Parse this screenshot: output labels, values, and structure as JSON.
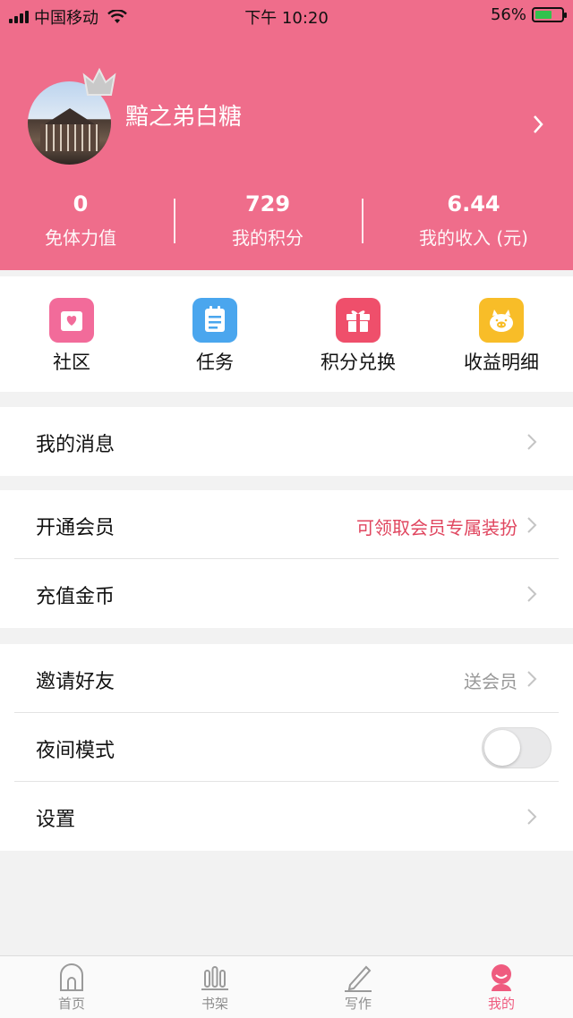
{
  "status_bar": {
    "carrier": "中国移动",
    "time": "下午 10:20",
    "battery": "56%"
  },
  "profile": {
    "username": "黯之弟白糖"
  },
  "stats": [
    {
      "value": "0",
      "label": "免体力值"
    },
    {
      "value": "729",
      "label": "我的积分"
    },
    {
      "value": "6.44",
      "label": "我的收入 (元)"
    }
  ],
  "quick_actions": [
    {
      "label": "社区",
      "icon": "community-icon",
      "color": "#f26b9a"
    },
    {
      "label": "任务",
      "icon": "task-icon",
      "color": "#4aa6ee"
    },
    {
      "label": "积分兑换",
      "icon": "gift-icon",
      "color": "#ef4f6b"
    },
    {
      "label": "收益明细",
      "icon": "piggy-bank-icon",
      "color": "#f8bd28"
    }
  ],
  "menu": {
    "messages": {
      "label": "我的消息"
    },
    "vip": {
      "label": "开通会员",
      "hint": "可领取会员专属装扮"
    },
    "recharge": {
      "label": "充值金币"
    },
    "invite": {
      "label": "邀请好友",
      "hint": "送会员"
    },
    "night_mode": {
      "label": "夜间模式",
      "enabled": false
    },
    "settings": {
      "label": "设置"
    }
  },
  "tabs": [
    {
      "label": "首页",
      "icon": "home-icon",
      "active": false
    },
    {
      "label": "书架",
      "icon": "bookshelf-icon",
      "active": false
    },
    {
      "label": "写作",
      "icon": "pen-icon",
      "active": false
    },
    {
      "label": "我的",
      "icon": "profile-icon",
      "active": true
    }
  ],
  "colors": {
    "accent": "#ef6d8b",
    "hint_red": "#e0465f",
    "hint_gray": "#999999"
  }
}
